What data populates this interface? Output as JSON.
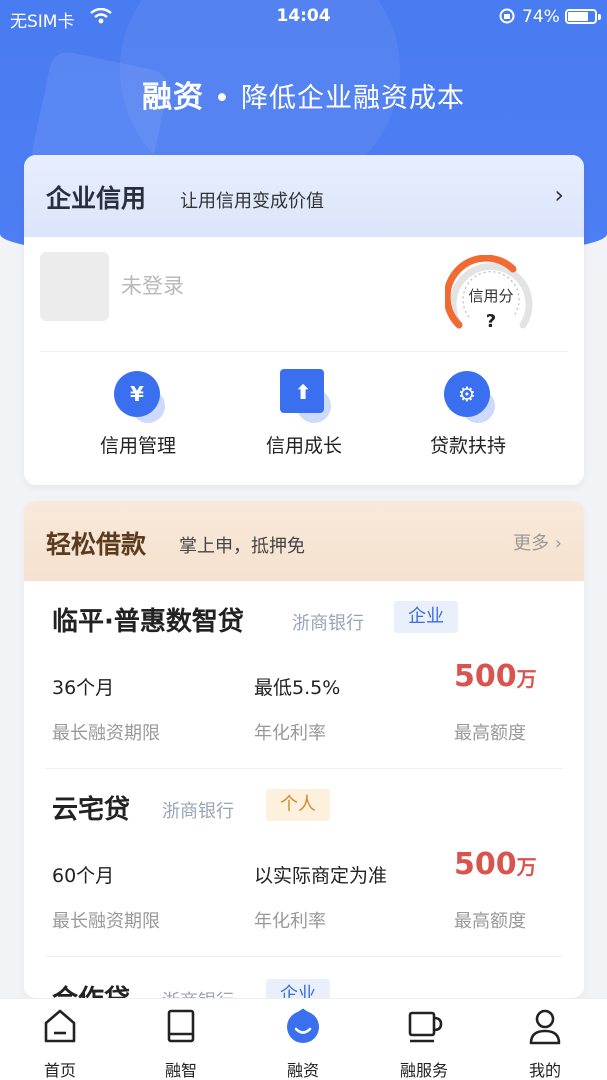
{
  "status_bar": {
    "carrier": "无SIM卡",
    "time": "14:04",
    "battery": "74%"
  },
  "hero": {
    "title_bold": "融资",
    "dot": "•",
    "title_rest": "降低企业融资成本"
  },
  "credit": {
    "title": "企业信用",
    "subtitle": "让用信用变成价值",
    "login_text": "未登录",
    "gauge_label": "信用分",
    "gauge_value": "?",
    "actions": [
      {
        "label": "信用管理",
        "icon": "yen-hand-icon"
      },
      {
        "label": "信用成长",
        "icon": "upload-arrow-icon"
      },
      {
        "label": "贷款扶持",
        "icon": "gear-icon"
      }
    ]
  },
  "loans": {
    "title": "轻松借款",
    "subtitle": "掌上申，抵押免",
    "more": "更多",
    "items": [
      {
        "name": "临平·普惠数智贷",
        "bank": "浙商银行",
        "tag": "企业",
        "term": "36个月",
        "term_label": "最长融资期限",
        "rate": "最低5.5%",
        "rate_label": "年化利率",
        "amount": "500",
        "amount_unit": "万",
        "amount_label": "最高额度"
      },
      {
        "name": "云宅贷",
        "bank": "浙商银行",
        "tag": "个人",
        "term": "60个月",
        "term_label": "最长融资期限",
        "rate": "以实际商定为准",
        "rate_label": "年化利率",
        "amount": "500",
        "amount_unit": "万",
        "amount_label": "最高额度"
      },
      {
        "name": "合作贷",
        "bank": "浙商银行",
        "tag": "企业"
      }
    ]
  },
  "tabbar": {
    "items": [
      {
        "label": "首页",
        "icon": "home-icon"
      },
      {
        "label": "融智",
        "icon": "book-icon"
      },
      {
        "label": "融资",
        "icon": "finance-icon",
        "active": true
      },
      {
        "label": "融服务",
        "icon": "cup-icon"
      },
      {
        "label": "我的",
        "icon": "user-icon"
      }
    ]
  },
  "colors": {
    "primary": "#4a7cf1",
    "accent_red": "#d9534f",
    "gauge_orange": "#f06a32"
  }
}
